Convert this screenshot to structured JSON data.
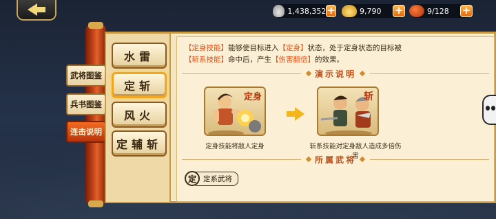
{
  "topbar": {
    "back_icon": "back-arrow-icon",
    "silver": "1,438,352",
    "gold": "9,790",
    "stamina": "9/128",
    "plus_label": "+"
  },
  "side_tabs": [
    {
      "label": "武将图鉴",
      "active": false
    },
    {
      "label": "兵书图鉴",
      "active": false
    },
    {
      "label": "连击说明",
      "active": true
    }
  ],
  "categories": [
    {
      "label": "水雷",
      "active": false
    },
    {
      "label": "定斩",
      "active": true
    },
    {
      "label": "风火",
      "active": false
    },
    {
      "label": "定辅斩",
      "active": false
    }
  ],
  "description": {
    "tag1": "【定身技能】",
    "t1": "能够使目标进入",
    "tag2": "【定身】",
    "t2": "状态，处于定身状态的目标被",
    "tag3": "【斩系技能】",
    "t3": "命中后，产生",
    "tag4": "【伤害翻倍】",
    "t4": "的效果。"
  },
  "demo": {
    "title": "演示说明",
    "left_caption": "定身技能将敌人定身",
    "left_stamp": "定身",
    "right_caption": "斩系技能对定身敌人造成多倍伤害",
    "right_stamp": "斩"
  },
  "generals": {
    "title": "所属武将",
    "seal": "定",
    "label": "定系武将"
  }
}
